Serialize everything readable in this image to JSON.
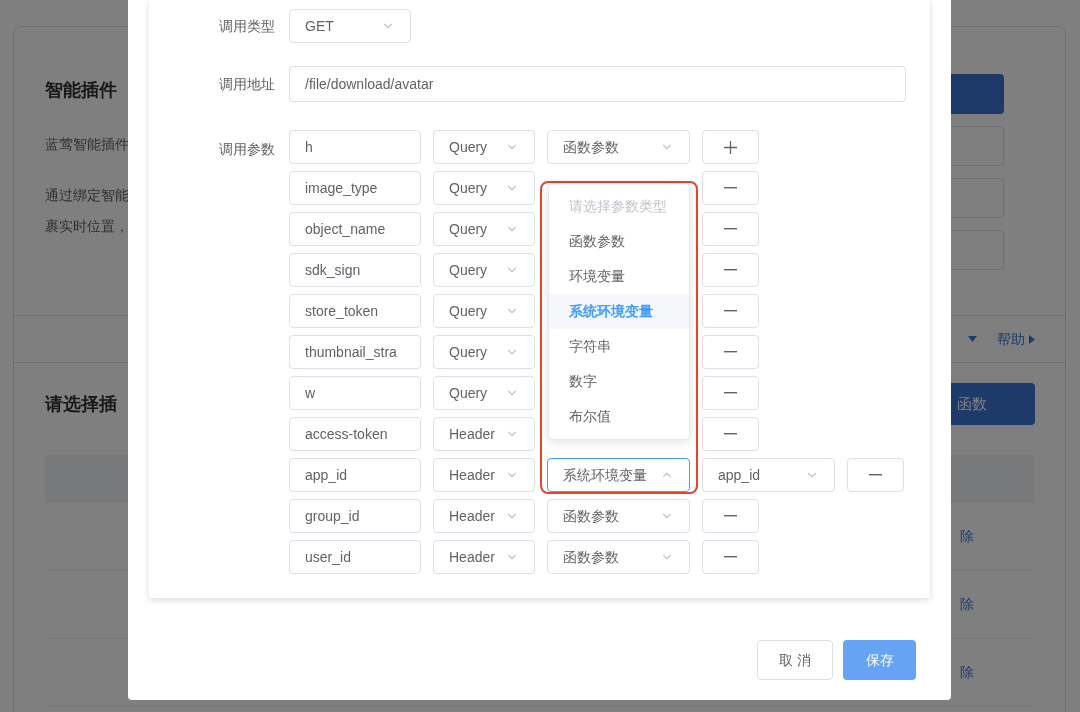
{
  "background": {
    "title": "智能插件",
    "lines": [
      "蓝莺智能插件",
      "通过绑定智能",
      "裹实时位置，"
    ],
    "help": "帮助",
    "section_title": "请选择插",
    "add_button": "函数",
    "row_actions": [
      "除",
      "除",
      "除"
    ]
  },
  "dialog": {
    "fields": [
      {
        "label": "调用类型",
        "kind": "select",
        "value": "GET"
      },
      {
        "label": "调用地址",
        "kind": "input",
        "value": "/file/download/avatar"
      }
    ],
    "params_label": "调用参数",
    "params": [
      {
        "name": "h",
        "location": "Query",
        "source": "函数参数",
        "open": false,
        "kind": "add"
      },
      {
        "name": "image_type",
        "location": "Query",
        "kind": "remove"
      },
      {
        "name": "object_name",
        "location": "Query",
        "kind": "remove"
      },
      {
        "name": "sdk_sign",
        "location": "Query",
        "kind": "remove"
      },
      {
        "name": "store_token",
        "location": "Query",
        "kind": "remove"
      },
      {
        "name": "thumbnail_stra",
        "location": "Query",
        "kind": "remove"
      },
      {
        "name": "w",
        "location": "Query",
        "kind": "remove"
      },
      {
        "name": "access-token",
        "location": "Header",
        "kind": "remove"
      },
      {
        "name": "app_id",
        "location": "Header",
        "source": "系统环境变量",
        "open": true,
        "env_value": "app_id",
        "kind": "remove"
      },
      {
        "name": "group_id",
        "location": "Header",
        "source": "函数参数",
        "open": false,
        "kind": "remove"
      },
      {
        "name": "user_id",
        "location": "Header",
        "source": "函数参数",
        "open": false,
        "kind": "remove"
      }
    ],
    "dropdown": {
      "options": [
        {
          "label": "请选择参数类型",
          "disabled": true,
          "selected": false
        },
        {
          "label": "函数参数",
          "disabled": false,
          "selected": false
        },
        {
          "label": "环境变量",
          "disabled": false,
          "selected": false
        },
        {
          "label": "系统环境变量",
          "disabled": false,
          "selected": true
        },
        {
          "label": "字符串",
          "disabled": false,
          "selected": false
        },
        {
          "label": "数字",
          "disabled": false,
          "selected": false
        },
        {
          "label": "布尔值",
          "disabled": false,
          "selected": false
        }
      ]
    },
    "buttons": [
      {
        "label": "取 消",
        "kind": "secondary"
      },
      {
        "label": "保存",
        "kind": "primary"
      }
    ]
  }
}
